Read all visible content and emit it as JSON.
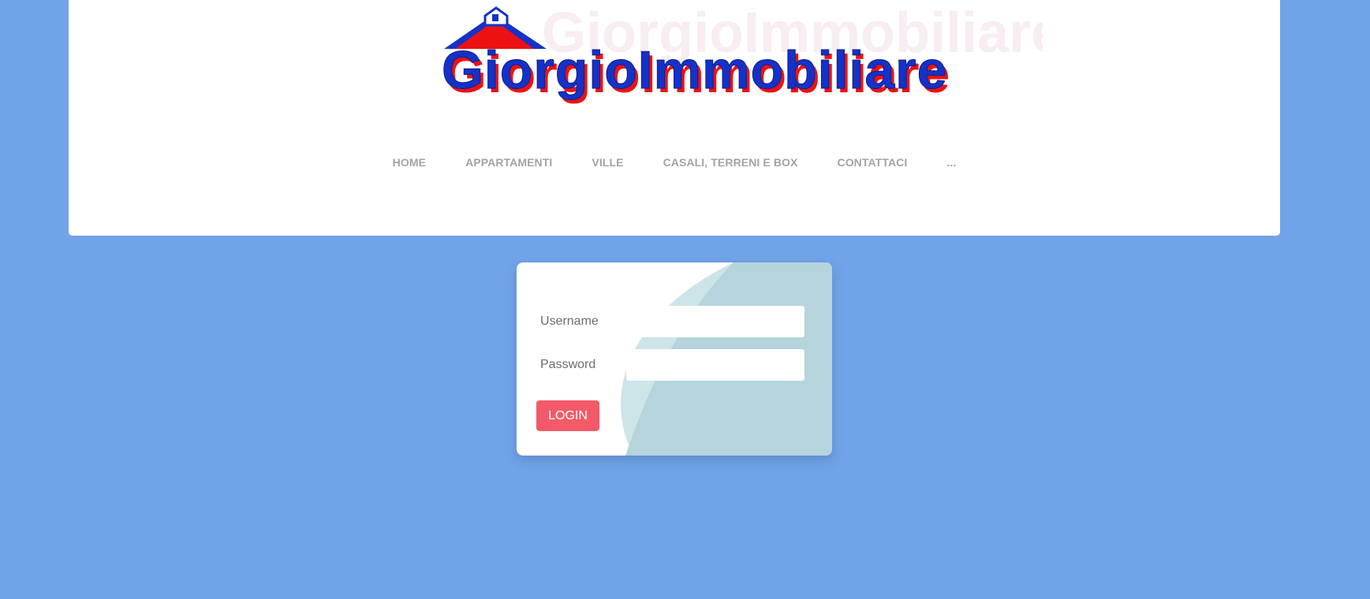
{
  "logo": {
    "text": "GiorgioImmobiliare",
    "colors": {
      "fill": "#1432c8",
      "shadow": "#ee1111",
      "roof": "#ee1111"
    }
  },
  "nav": {
    "items": [
      {
        "label": "HOME"
      },
      {
        "label": "APPARTAMENTI"
      },
      {
        "label": "VILLE"
      },
      {
        "label": "CASALI, TERRENI E BOX"
      },
      {
        "label": "CONTATTACI"
      },
      {
        "label": "..."
      }
    ]
  },
  "login": {
    "username_label": "Username",
    "username_value": "",
    "password_label": "Password",
    "password_value": "",
    "button_label": "LOGIN"
  },
  "colors": {
    "background": "#71a3e8",
    "button": "#f25a69",
    "card_accent": "#b5d4dc"
  }
}
